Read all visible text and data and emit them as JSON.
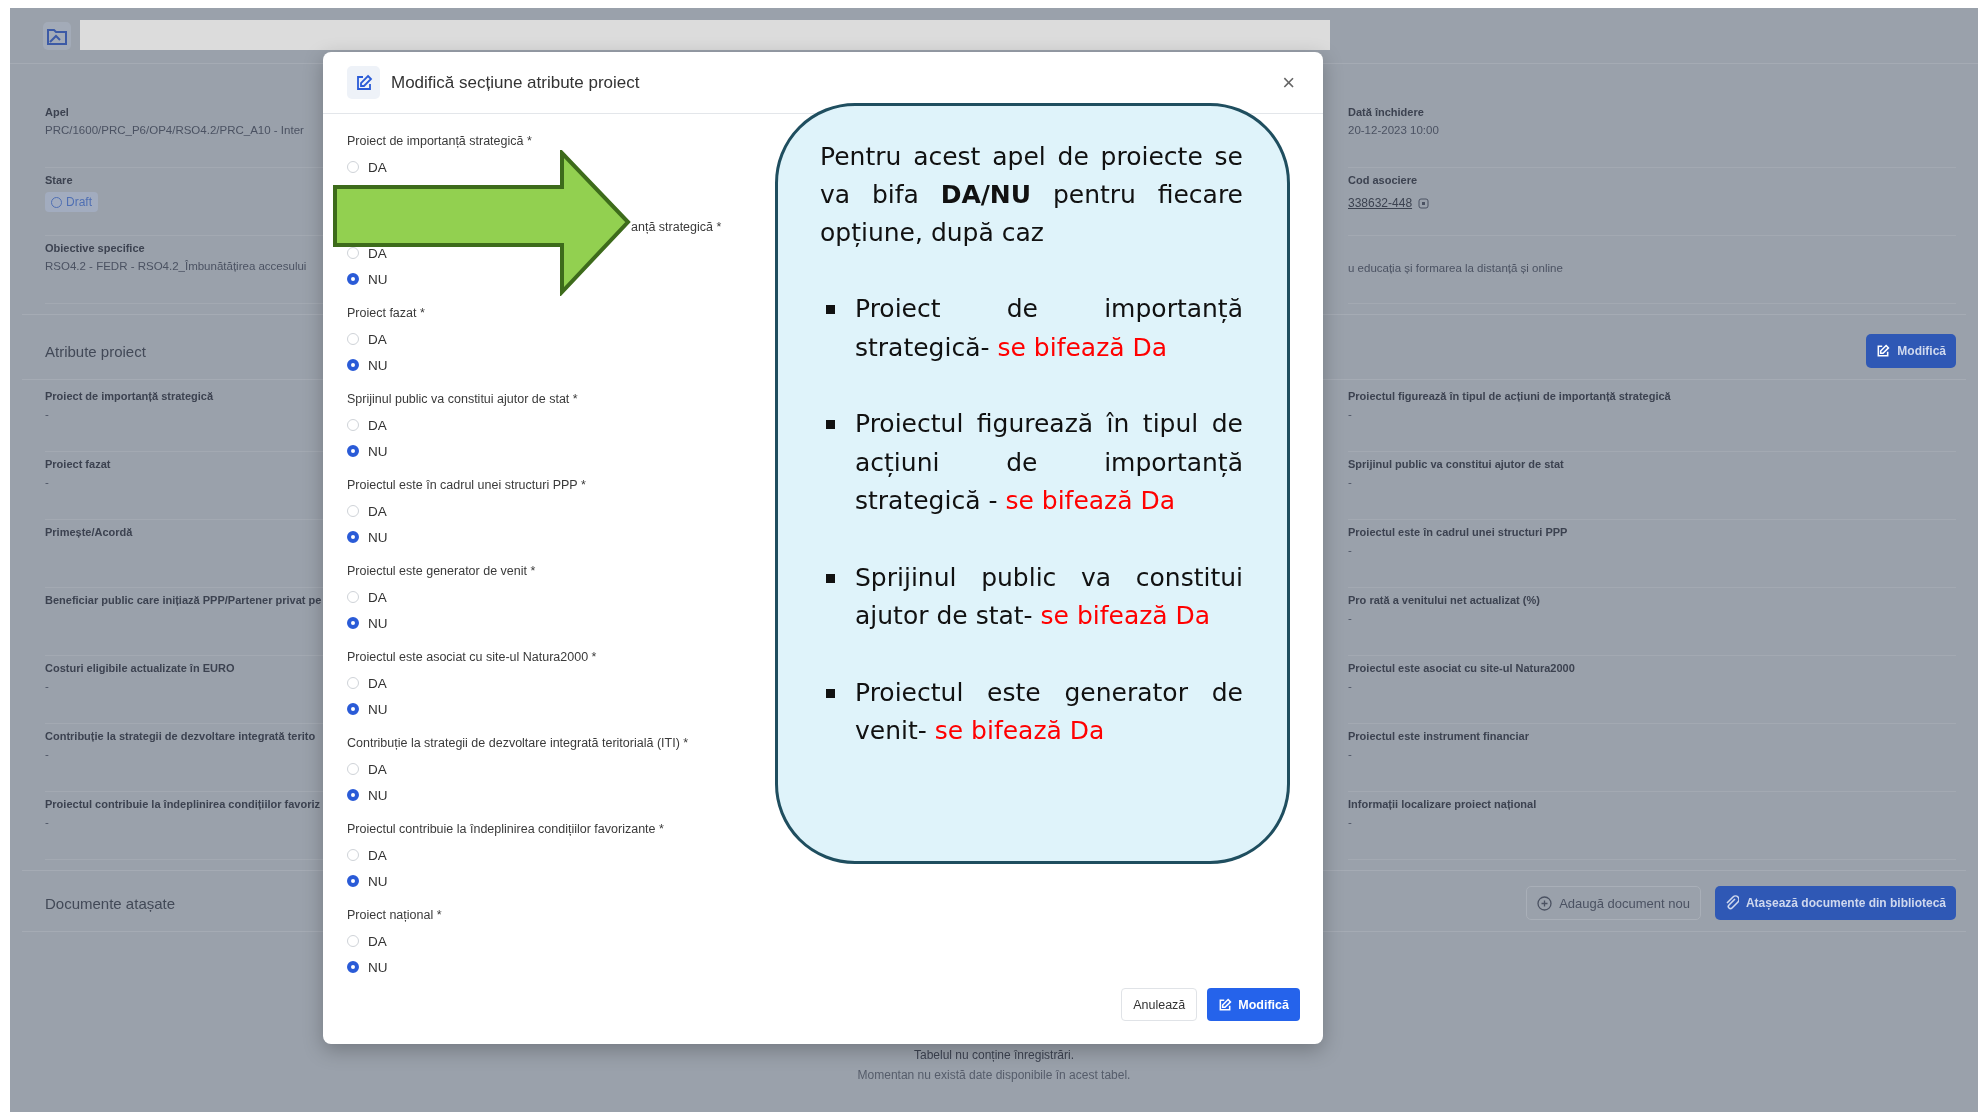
{
  "page": {
    "summary": {
      "left": [
        {
          "label": "Apel",
          "value": "PRC/1600/PRC_P6/OP4/RSO4.2/PRC_A10 - Inter",
          "kind": "text"
        },
        {
          "label": "Stare",
          "value": "Draft",
          "kind": "badge"
        },
        {
          "label": "Obiective specifice",
          "value": "RSO4.2 - FEDR - RSO4.2_Îmbunătățirea accesului",
          "kind": "text"
        }
      ],
      "right": [
        {
          "label": "Dată închidere",
          "value": "20-12-2023 10:00",
          "kind": "text"
        },
        {
          "label": "Cod asociere",
          "value": "338632-448",
          "kind": "link"
        },
        {
          "value": "u educația și formarea la distanță și online",
          "kind": "text"
        }
      ]
    },
    "attributes": {
      "title": "Atribute proiect",
      "button": "Modifică",
      "left": [
        {
          "label": "Proiect de importanță strategică",
          "value": "-"
        },
        {
          "label": "Proiect fazat",
          "value": "-"
        },
        {
          "label": "Primește/Acordă"
        },
        {
          "label": "Beneficiar public care inițiază PPP/Partener privat pe"
        },
        {
          "label": "Costuri eligibile actualizate în EURO",
          "value": "-"
        },
        {
          "label": "Contribuție la strategii de dezvoltare integrată terito",
          "value": "-"
        },
        {
          "label": "Proiectul contribuie la îndeplinirea condițiilor favoriz",
          "value": "-"
        }
      ],
      "right": [
        {
          "label": "Proiectul figurează în tipul de acțiuni de importanță strategică",
          "value": "-"
        },
        {
          "label": "Sprijinul public va constitui ajutor de stat",
          "value": "-"
        },
        {
          "label": "Proiectul este în cadrul unei structuri PPP",
          "value": "-"
        },
        {
          "label": "Pro rată a venitului net actualizat (%)",
          "value": "-"
        },
        {
          "label": "Proiectul este asociat cu site-ul Natura2000",
          "value": "-"
        },
        {
          "label": "Proiectul este instrument financiar",
          "value": "-"
        },
        {
          "label": "Informații localizare proiect național",
          "value": "-"
        }
      ]
    },
    "documents": {
      "title": "Documente atașate",
      "buttons": [
        {
          "label": "Adaugă document nou",
          "kind": "secondary"
        },
        {
          "label": "Atașează documente din bibliotecă",
          "kind": "primary"
        }
      ],
      "empty_title": "Tabelul nu conține înregistrări.",
      "empty_text": "Momentan nu există date disponibile în acest tabel."
    }
  },
  "modal": {
    "title": "Modifică secțiune atribute proiect",
    "close": "×",
    "questions": [
      {
        "label": "Proiect de importanță strategică *",
        "kind": "full",
        "options": [
          {
            "label": "DA",
            "selected": false
          }
        ]
      },
      {
        "label": "anță strategică *",
        "kind": "cut",
        "options": [
          {
            "label": "DA",
            "selected": false
          },
          {
            "label": "NU",
            "selected": true
          }
        ]
      },
      {
        "label": "Proiect fazat *",
        "kind": "full",
        "options": [
          {
            "label": "DA",
            "selected": false
          },
          {
            "label": "NU",
            "selected": true
          }
        ]
      },
      {
        "label": "Sprijinul public va constitui ajutor de stat *",
        "kind": "full",
        "options": [
          {
            "label": "DA",
            "selected": false
          },
          {
            "label": "NU",
            "selected": true
          }
        ]
      },
      {
        "label": "Proiectul este în cadrul unei structuri PPP *",
        "kind": "full",
        "options": [
          {
            "label": "DA",
            "selected": false
          },
          {
            "label": "NU",
            "selected": true
          }
        ]
      },
      {
        "label": "Proiectul este generator de venit *",
        "kind": "full",
        "options": [
          {
            "label": "DA",
            "selected": false
          },
          {
            "label": "NU",
            "selected": true
          }
        ]
      },
      {
        "label": "Proiectul este asociat cu site-ul Natura2000 *",
        "kind": "full",
        "options": [
          {
            "label": "DA",
            "selected": false
          },
          {
            "label": "NU",
            "selected": true
          }
        ]
      },
      {
        "label": "Contribuție la strategii de dezvoltare integrată teritorială (ITI) *",
        "kind": "full",
        "options": [
          {
            "label": "DA",
            "selected": false
          },
          {
            "label": "NU",
            "selected": true
          }
        ]
      },
      {
        "label": "Proiectul contribuie la îndeplinirea condițiilor favorizante *",
        "kind": "full",
        "options": [
          {
            "label": "DA",
            "selected": false
          },
          {
            "label": "NU",
            "selected": true
          }
        ]
      },
      {
        "label": "Proiect național *",
        "kind": "full",
        "options": [
          {
            "label": "DA",
            "selected": false
          },
          {
            "label": "NU",
            "selected": true
          }
        ]
      }
    ],
    "buttons": [
      {
        "label": "Anulează",
        "kind": "secondary"
      },
      {
        "label": "Modifică",
        "kind": "primary"
      }
    ]
  },
  "callout": {
    "intro": "Pentru acest apel de proiecte se va bifa **DA/NU** pentru fiecare opțiune, după caz",
    "bullets": [
      {
        "text": "Proiect de importanță strategică- ",
        "highlight": "se bifează Da"
      },
      {
        "text": "Proiectul figurează în tipul de acțiuni de importanță strategică - ",
        "highlight": "se bifează Da"
      },
      {
        "text": "Sprijinul public va constitui ajutor de stat- ",
        "highlight": "se bifează Da"
      },
      {
        "text": "Proiectul este generator de venit- ",
        "highlight": "se bifează Da"
      }
    ]
  }
}
